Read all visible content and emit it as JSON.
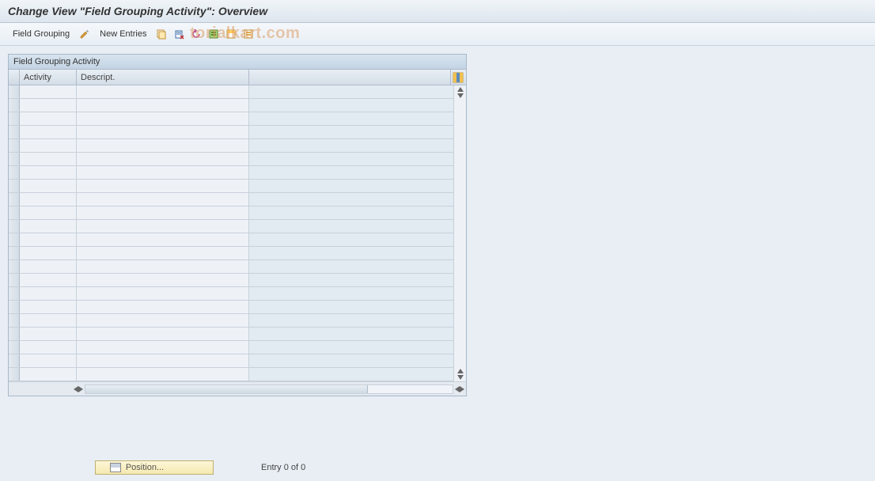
{
  "title": "Change View \"Field Grouping Activity\": Overview",
  "toolbar": {
    "field_grouping_label": "Field Grouping",
    "new_entries_label": "New Entries"
  },
  "watermark": "torialkart.com",
  "panel": {
    "title": "Field Grouping Activity",
    "columns": {
      "activity": "Activity",
      "descript": "Descript."
    },
    "row_count": 22
  },
  "footer": {
    "position_label": "Position...",
    "entry_status": "Entry 0 of 0"
  }
}
